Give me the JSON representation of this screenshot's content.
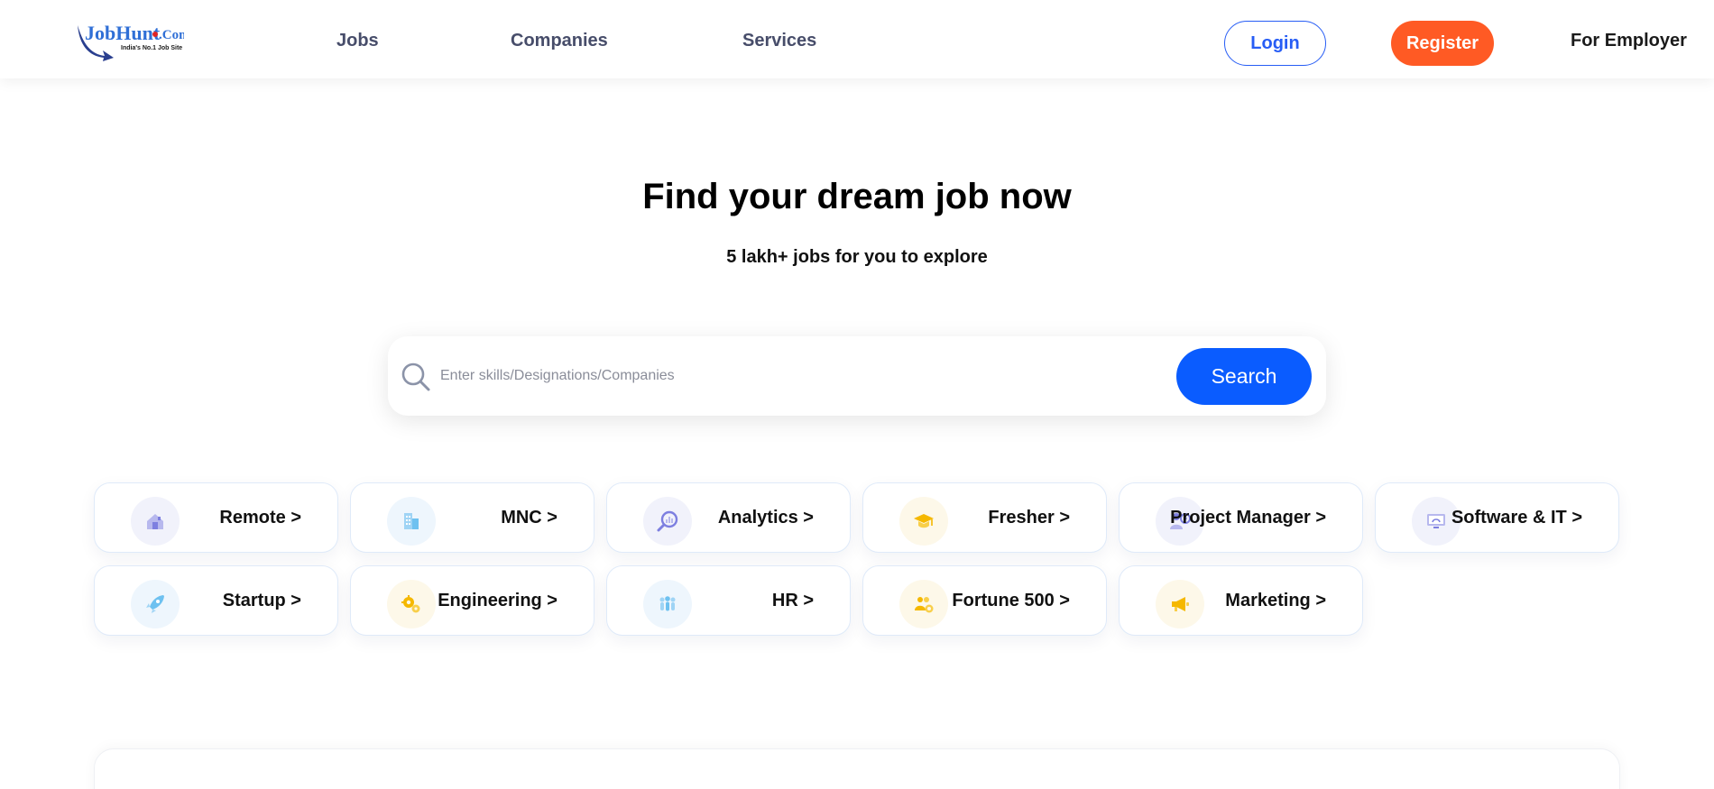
{
  "logo": {
    "brand": "JobHunt",
    "suffix": ".Com",
    "tagline": "India's No.1 Job Site"
  },
  "nav": {
    "links": [
      "Jobs",
      "Companies",
      "Services"
    ],
    "login": "Login",
    "register": "Register",
    "employer": "For Employer"
  },
  "hero": {
    "title": "Find your dream job now",
    "subtitle": "5 lakh+ jobs for you to explore"
  },
  "search": {
    "placeholder": "Enter skills/Designations/Companies",
    "value": "",
    "button": "Search"
  },
  "categories": [
    {
      "label": "Remote >",
      "icon": "remote-home-icon"
    },
    {
      "label": "MNC >",
      "icon": "building-icon"
    },
    {
      "label": "Analytics >",
      "icon": "analytics-magnifier-icon"
    },
    {
      "label": "Fresher >",
      "icon": "graduation-cap-icon"
    },
    {
      "label": "Project Manager >",
      "icon": "project-manager-icon"
    },
    {
      "label": "Software & IT >",
      "icon": "monitor-icon"
    },
    {
      "label": "Startup >",
      "icon": "rocket-icon"
    },
    {
      "label": "Engineering >",
      "icon": "gears-icon"
    },
    {
      "label": "HR >",
      "icon": "people-icon"
    },
    {
      "label": "Fortune 500 >",
      "icon": "team-badge-icon"
    },
    {
      "label": "Marketing >",
      "icon": "megaphone-icon"
    }
  ],
  "colors": {
    "primary": "#275df5",
    "search_button": "#0a5cff",
    "register": "#ff5a24",
    "nav_text": "#474d6a"
  }
}
